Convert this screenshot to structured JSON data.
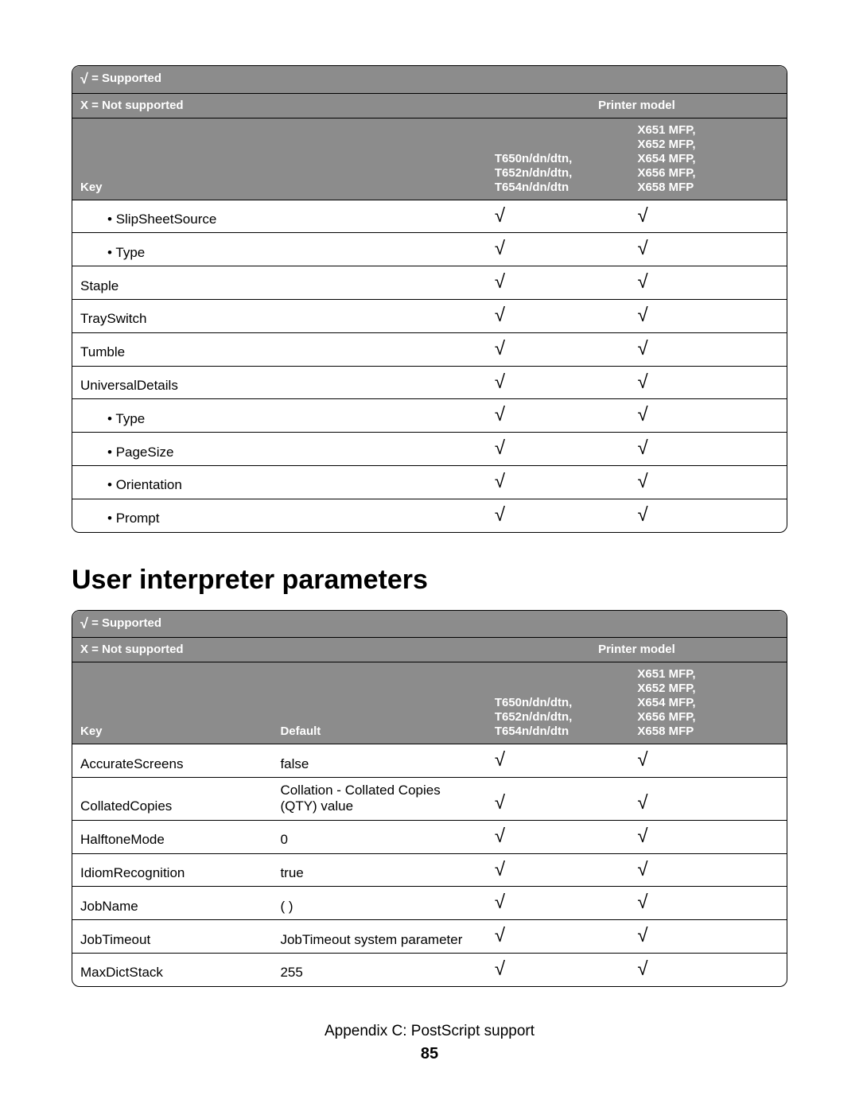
{
  "legend": {
    "supported": "= Supported",
    "not_supported": "X = Not supported",
    "check_glyph": "√"
  },
  "columns": {
    "key": "Key",
    "default": "Default",
    "printer_model": "Printer model",
    "model1": "T650n/dn/dtn,\nT652n/dn/dtn,\nT654n/dn/dtn",
    "model2": "X651 MFP,\nX652 MFP,\nX654 MFP,\nX656 MFP,\nX658 MFP"
  },
  "table1": {
    "rows": [
      {
        "key": "SlipSheetSource",
        "indent": 1,
        "m1": "√",
        "m2": "√"
      },
      {
        "key": "Type",
        "indent": 1,
        "m1": "√",
        "m2": "√"
      },
      {
        "key": "Staple",
        "indent": 0,
        "m1": "√",
        "m2": "√"
      },
      {
        "key": "TraySwitch",
        "indent": 0,
        "m1": "√",
        "m2": "√"
      },
      {
        "key": "Tumble",
        "indent": 0,
        "m1": "√",
        "m2": "√"
      },
      {
        "key": "UniversalDetails",
        "indent": 0,
        "m1": "√",
        "m2": "√"
      },
      {
        "key": "Type",
        "indent": 1,
        "m1": "√",
        "m2": "√"
      },
      {
        "key": "PageSize",
        "indent": 1,
        "m1": "√",
        "m2": "√"
      },
      {
        "key": "Orientation",
        "indent": 1,
        "m1": "√",
        "m2": "√"
      },
      {
        "key": "Prompt",
        "indent": 1,
        "m1": "√",
        "m2": "√"
      }
    ]
  },
  "section_heading": "User interpreter parameters",
  "table2": {
    "rows": [
      {
        "key": "AccurateScreens",
        "default": "false",
        "m1": "√",
        "m2": "√"
      },
      {
        "key": "CollatedCopies",
        "default": "Collation - Collated Copies (QTY) value",
        "m1": "√",
        "m2": "√"
      },
      {
        "key": "HalftoneMode",
        "default": "0",
        "m1": "√",
        "m2": "√"
      },
      {
        "key": "IdiomRecognition",
        "default": "true",
        "m1": "√",
        "m2": "√"
      },
      {
        "key": "JobName",
        "default": "( )",
        "m1": "√",
        "m2": "√"
      },
      {
        "key": "JobTimeout",
        "default": "JobTimeout system parameter",
        "m1": "√",
        "m2": "√"
      },
      {
        "key": "MaxDictStack",
        "default": "255",
        "m1": "√",
        "m2": "√"
      }
    ]
  },
  "footer": {
    "appendix": "Appendix C: PostScript support",
    "page": "85"
  }
}
